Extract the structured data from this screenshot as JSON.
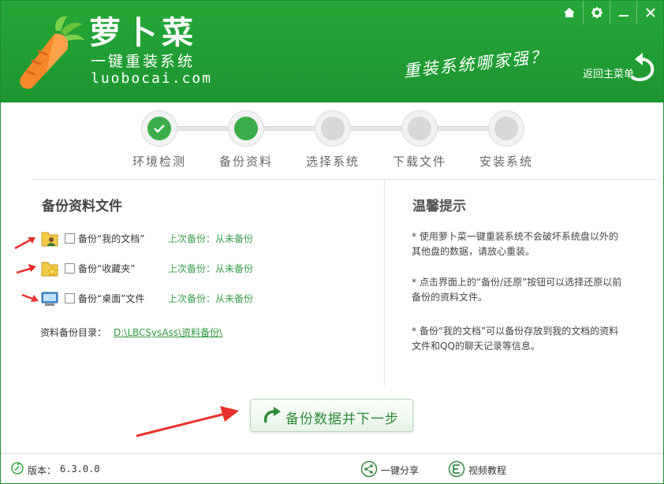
{
  "header": {
    "brand_title": "萝卜菜",
    "brand_subtitle": "一键重装系统",
    "brand_url": "luobocai.com",
    "slogan": "重装系统哪家强？",
    "back_main": "返回主菜单"
  },
  "window_controls": [
    "home-icon",
    "gear-icon",
    "minimize-icon",
    "close-icon"
  ],
  "steps": [
    {
      "label": "环境检测",
      "state": "done"
    },
    {
      "label": "备份资料",
      "state": "active"
    },
    {
      "label": "选择系统",
      "state": "pending"
    },
    {
      "label": "下载文件",
      "state": "pending"
    },
    {
      "label": "安装系统",
      "state": "pending"
    }
  ],
  "backup": {
    "title": "备份资料文件",
    "items": [
      {
        "text": "备份“我的文档”",
        "last": "上次备份：从未备份",
        "icon": "documents-folder-icon"
      },
      {
        "text": "备份“收藏夹”",
        "last": "上次备份：从未备份",
        "icon": "favorites-folder-icon"
      },
      {
        "text": "备份“桌面”文件",
        "last": "上次备份：从未备份",
        "icon": "desktop-icon"
      }
    ],
    "dir_label": "资料备份目录：",
    "dir_path": "D:\\LBCSysAss\\资料备份\\"
  },
  "tips": {
    "title": "温馨提示",
    "items": [
      "* 使用萝卜菜一键重装系统不会破坏系统盘以外的其他盘的数据，请放心重装。",
      "* 点击界面上的“备份/还原”按钮可以选择还原以前备份的资料文件。",
      "* 备份“我的文档”可以备份存放到我的文档的资料文件和QQ的聊天记录等信息。"
    ]
  },
  "next_button": "备份数据并下一步",
  "footer": {
    "version_label": "版本：",
    "version": "6.3.0.0",
    "share": "一键分享",
    "tutorial": "视频教程"
  },
  "colors": {
    "brand": "#1f9a32",
    "accent_green": "#3aad48",
    "link": "#2f9a3c",
    "arrow_red": "#e8312a"
  }
}
